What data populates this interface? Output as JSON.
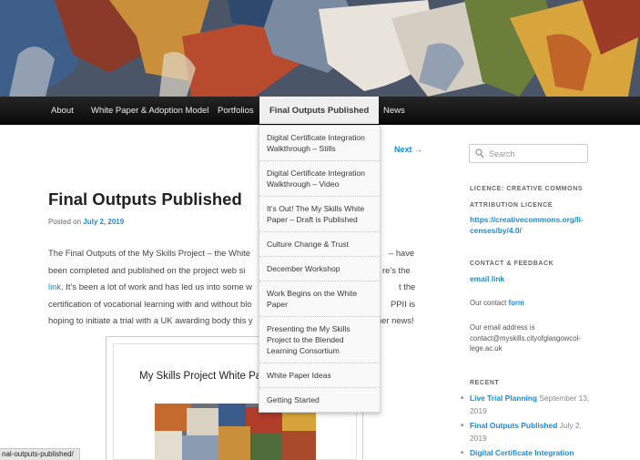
{
  "nav": {
    "items": [
      {
        "label": "About"
      },
      {
        "label": "White Paper & Adoption Model"
      },
      {
        "label": "Portfolios"
      },
      {
        "label": "Final Outputs Published"
      },
      {
        "label": "News"
      }
    ]
  },
  "dropdown": {
    "items": [
      "Digital Certificate Integration Walkthrough – Stills",
      "Digital Certificate Integration Walkthrough – Video",
      "It’s Out! The My Skills White Paper – Draft is Published",
      "Culture Change & Trust",
      "December Workshop",
      "Work Begins on the White Paper",
      "Presenting the My Skills Project to the Blended Learning Consortium",
      "White Paper Ideas",
      "Getting Started"
    ]
  },
  "post": {
    "nav_next": "Next →",
    "nav_partial": "s",
    "title": "Final Outputs Published",
    "posted_on": "Posted on",
    "date": "July 2, 2019",
    "body": {
      "l1a": "The Final Outputs of the My Skills Project – the White",
      "l1b": "– have",
      "l2a": "been completed and published on the project web si",
      "l2b": "re’s the",
      "l3link": "link",
      "l3a": ". It’s been a lot of work and has led us into some w",
      "l3b": "t the",
      "l4a": "certification of vocational learning with and without blo",
      "l4b": "PPII is",
      "l5a": "hoping to initiate a trial with a UK awarding body this y",
      "l5b": "her news!"
    },
    "doc_title": "My Skills Project White Pap 2019"
  },
  "sidebar": {
    "search_placeholder": "Search",
    "licence_heading": "Licence: Creative Commons",
    "attribution_heading": "Attribution Licence",
    "licence_link": "https://creativecommons.org/li- censes/by/4.0/",
    "contact_heading": "Contact & Feedback",
    "email_link": "email link",
    "our_contact": "Our contact",
    "form_link": "form",
    "email_text": "Our email address is contact@myskills.cityofglasgowcol- lege.ac.uk",
    "recent_heading": "Recent",
    "recent": [
      {
        "title": "Live Trial Planning",
        "date": "September 13, 2019"
      },
      {
        "title": "Final Outputs Published",
        "date": "July 2, 2019"
      },
      {
        "title": "Digital Certificate Integration",
        "date": ""
      }
    ]
  },
  "status_url": "nal-outputs-published/",
  "colors": {
    "link": "#1b8be0",
    "navbar": "#111111"
  }
}
